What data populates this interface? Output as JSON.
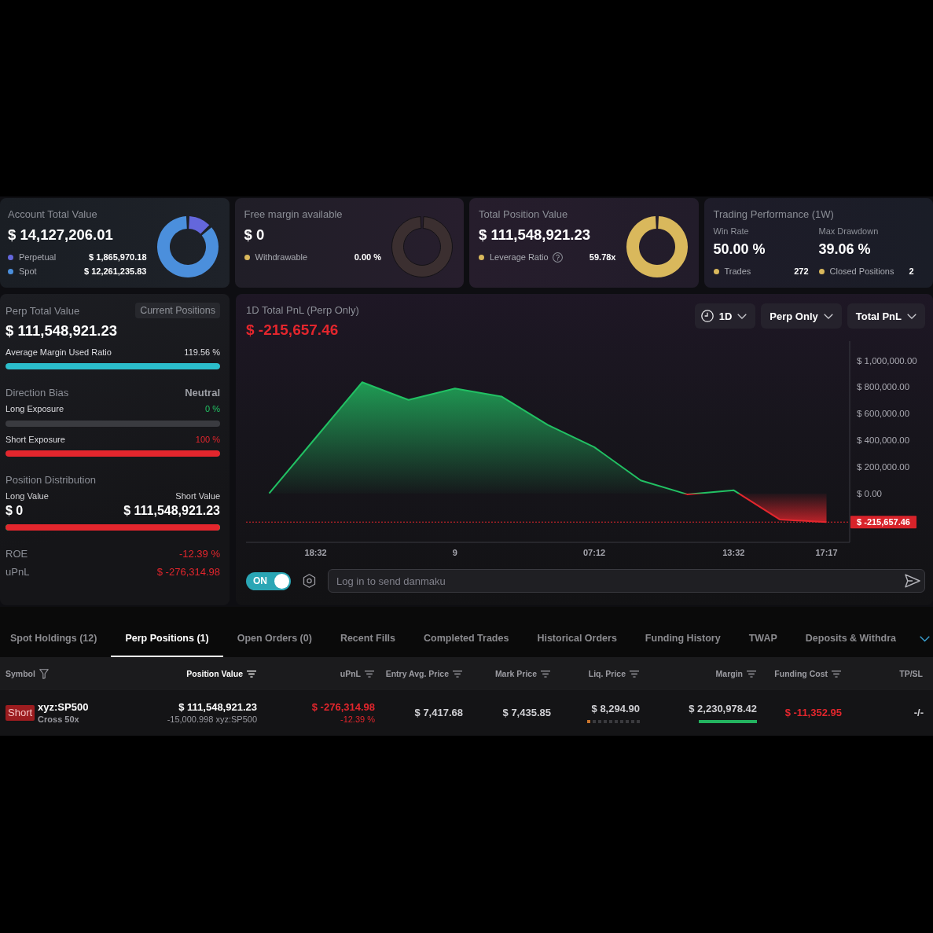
{
  "summary_cards": [
    {
      "kind": "breakdown",
      "title": "Account Total Value",
      "value": "$ 14,127,206.01",
      "legend": [
        {
          "label": "Perpetual",
          "value": "$ 1,865,970.18",
          "color": "#6467dc",
          "help": false
        },
        {
          "label": "Spot",
          "value": "$ 12,261,235.83",
          "color": "#4b8fdc",
          "help": false
        }
      ],
      "chart_data": {
        "type": "donut",
        "values": [
          13.21,
          86.79
        ]
      }
    },
    {
      "kind": "empty",
      "title": "Free margin available",
      "value": "$ 0",
      "legend": [
        {
          "label": "Withdrawable",
          "value": "0.00 %",
          "color": "#d9b85c",
          "help": false
        }
      ]
    },
    {
      "kind": "full",
      "title": "Total Position Value",
      "value": "$ 111,548,921.23",
      "legend": [
        {
          "label": "Leverage Ratio",
          "value": "59.78x",
          "color": "#d9b85c",
          "help": true
        }
      ]
    },
    {
      "kind": "performance",
      "title": "Trading Performance (1W)",
      "metrics": [
        {
          "label": "Win Rate",
          "value": "50.00 %"
        },
        {
          "label": "Max Drawdown",
          "value": "39.06 %"
        }
      ],
      "stats": [
        {
          "label": "Trades",
          "value": "272"
        },
        {
          "label": "Closed Positions",
          "value": "2"
        }
      ]
    }
  ],
  "perp_panel": {
    "title": "Perp Total Value",
    "badge": "Current Positions",
    "value": "$ 111,548,921.23",
    "margin_ratio": {
      "label": "Average Margin Used Ratio",
      "reading": "119.56 %",
      "level": 1
    },
    "direction": {
      "title": "Direction Bias",
      "bias": "Neutral",
      "exposures": [
        {
          "kind": "long",
          "label": "Long Exposure",
          "reading": "0 %",
          "level": 0
        },
        {
          "kind": "short",
          "label": "Short Exposure",
          "reading": "100 %",
          "level": 1
        }
      ]
    },
    "distribution": {
      "title": "Position Distribution",
      "long_label": "Long Value",
      "long_value": "$ 0",
      "short_label": "Short Value",
      "short_value": "$ 111,548,921.23",
      "level": 1
    },
    "stats": [
      {
        "label": "ROE",
        "value": "-12.39 %"
      },
      {
        "label": "uPnL",
        "value": "$ -276,314.98"
      }
    ]
  },
  "pnl_chart": {
    "title": "1D Total PnL (Perp Only)",
    "total": "$ -215,657.46",
    "filters": [
      {
        "kind": "period",
        "label": "1D"
      },
      {
        "kind": "select",
        "label": "Perp Only"
      },
      {
        "kind": "select",
        "label": "Total PnL"
      }
    ],
    "chart_data": {
      "type": "area",
      "categories": [
        null,
        "18:32",
        null,
        null,
        "9",
        null,
        null,
        "07:12",
        null,
        null,
        "13:32",
        null,
        "17:17"
      ],
      "series": [
        {
          "color": "#21c163",
          "values": [
            0,
            418000,
            836000,
            703000,
            789000,
            729000,
            515000,
            348000,
            97000,
            -7000,
            24000,
            -197000,
            -215657.46
          ]
        }
      ],
      "ylim": [
        -368000,
        1145000
      ],
      "yticks": [
        {
          "value": 0,
          "label": "$ 0.00"
        },
        {
          "value": 200000,
          "label": "$ 200,000.00"
        },
        {
          "value": 400000,
          "label": "$ 400,000.00"
        },
        {
          "value": 600000,
          "label": "$ 600,000.00"
        },
        {
          "value": 800000,
          "label": "$ 800,000.00"
        },
        {
          "value": 1000000,
          "label": "$ 1,000,000.00"
        }
      ],
      "ref_lines": [
        {
          "axis": "y",
          "value": -215657.46,
          "label": "$ -215,657.46"
        }
      ]
    },
    "danmaku": {
      "toggle": {
        "label": "ON",
        "on": true
      },
      "placeholder": "Log in to send danmaku"
    }
  },
  "tabs": [
    {
      "label": "Spot Holdings (12)",
      "selected": false
    },
    {
      "label": "Perp Positions (1)",
      "selected": true
    },
    {
      "label": "Open Orders (0)",
      "selected": false
    },
    {
      "label": "Recent Fills",
      "selected": false
    },
    {
      "label": "Completed Trades",
      "selected": false
    },
    {
      "label": "Historical Orders",
      "selected": false
    },
    {
      "label": "Funding History",
      "selected": false
    },
    {
      "label": "TWAP",
      "selected": false
    },
    {
      "label": "Deposits & Withdra",
      "selected": false
    }
  ],
  "table": {
    "columns": [
      {
        "label": "Symbol",
        "kind": "filter",
        "sorted": false
      },
      {
        "label": "Position Value",
        "kind": "sort",
        "sorted": true
      },
      {
        "label": "uPnL",
        "kind": "sort",
        "sorted": false
      },
      {
        "label": "Entry Avg. Price",
        "kind": "sort",
        "sorted": false
      },
      {
        "label": "Mark Price",
        "kind": "sort",
        "sorted": false
      },
      {
        "label": "Liq. Price",
        "kind": "sort",
        "sorted": false
      },
      {
        "label": "Margin",
        "kind": "sort",
        "sorted": false
      },
      {
        "label": "Funding Cost",
        "kind": "sort",
        "sorted": false
      },
      {
        "label": "TP/SL",
        "kind": "plain",
        "sorted": false
      }
    ],
    "rows": [
      {
        "side": {
          "kind": "short",
          "label": "Short"
        },
        "symbol": "xyz:SP500",
        "margin_mode": "Cross 50x",
        "position_value": "$ 111,548,921.23",
        "size": "-15,000.998 xyz:SP500",
        "upnl": "$ -276,314.98",
        "roe": "-12.39 %",
        "entry_price": "$ 7,417.68",
        "mark_price": "$ 7,435.85",
        "liq_price": "$ 8,294.90",
        "liq_risk": {
          "level": 0.1
        },
        "margin": "$ 2,230,978.42",
        "margin_usage": {
          "level": 1
        },
        "funding_cost": "$ -11,352.95",
        "tp_sl": "-/-"
      }
    ]
  }
}
